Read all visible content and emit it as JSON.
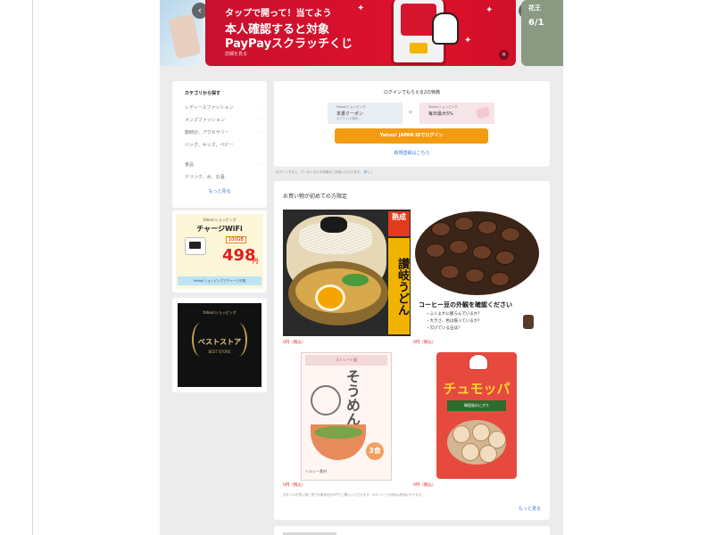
{
  "banner_main": {
    "line1": "タップで開って！当てよう",
    "line2": "本人確認すると対象",
    "line3": "PayPayスクラッチくじ",
    "small": "詳細を見る",
    "close": "×"
  },
  "banner_next": {
    "title": "花王",
    "date": "6/1"
  },
  "nav": {
    "prev": "‹",
    "next": "›"
  },
  "categories": {
    "title": "カテゴリから探す",
    "items": [
      "レディースファッション",
      "メンズファッション",
      "腕時計、アクセサリー",
      "バッグ、キッズ、ベビー",
      "食品",
      "ドリンク、水、お酒"
    ],
    "chevron": "›",
    "more": "もっと見る"
  },
  "ad_wifi": {
    "brand": "Yahoo!ショッピング",
    "name": "チャージWiFi",
    "plan": "100GB",
    "price": "498",
    "yen": "円",
    "footer": "Yahoo!ショッピングでチャージ可能"
  },
  "ad_store": {
    "top": "Yahoo!ショッピング",
    "best": "ベストストア",
    "sub": "BEST STORE"
  },
  "login": {
    "title": "ログインでもらえる2の特典",
    "coupon1": {
      "l1": "Yahoo!ショッピング",
      "l2": "本書クーポン",
      "l3": "ログインで表示"
    },
    "coupon2": {
      "l1": "Yahoo!ショッピング",
      "l2": "毎日最大5%",
      "l3": ""
    },
    "plus": "+",
    "button": "Yahoo! JAPAN IDでログイン",
    "signup": "新規登録はこちら"
  },
  "note": {
    "text": "ログインすると、クーポンなどの特典がご利用いただけます。",
    "link": "詳しく"
  },
  "deals": {
    "title": "お買い物が初めての方限定",
    "udon": {
      "jk": "熟成",
      "vertical": "讃岐うどん"
    },
    "coffee": {
      "headline": "コーヒー豆の外観を確認ください",
      "points": [
        "・ふくよかに膨らんでいるか？",
        "・大きさ、色は揃っているか？",
        "・欠けている豆は？"
      ]
    },
    "somen": {
      "head": "ストレート麺",
      "kana": "そうめん",
      "badge": "3食",
      "foot": "ヘルシー素材"
    },
    "chumon": {
      "title": "チュモッパ",
      "panel": "韓国風おにぎり"
    },
    "prices": [
      "0円（税込）",
      "0円（税込）",
      "0円（税込）",
      "0円（税込）"
    ],
    "desc": "初めてのお買い物に限り対象商品が0円でご購入いただけます。※ポイントや送料は別途かかります。",
    "more": "もっと見る"
  },
  "colors": {
    "page_bg": "#ececec",
    "banner_red": "#d8102b",
    "login_orange": "#f39c12",
    "link_blue": "#3b78d8",
    "price_red": "#e0202a"
  }
}
